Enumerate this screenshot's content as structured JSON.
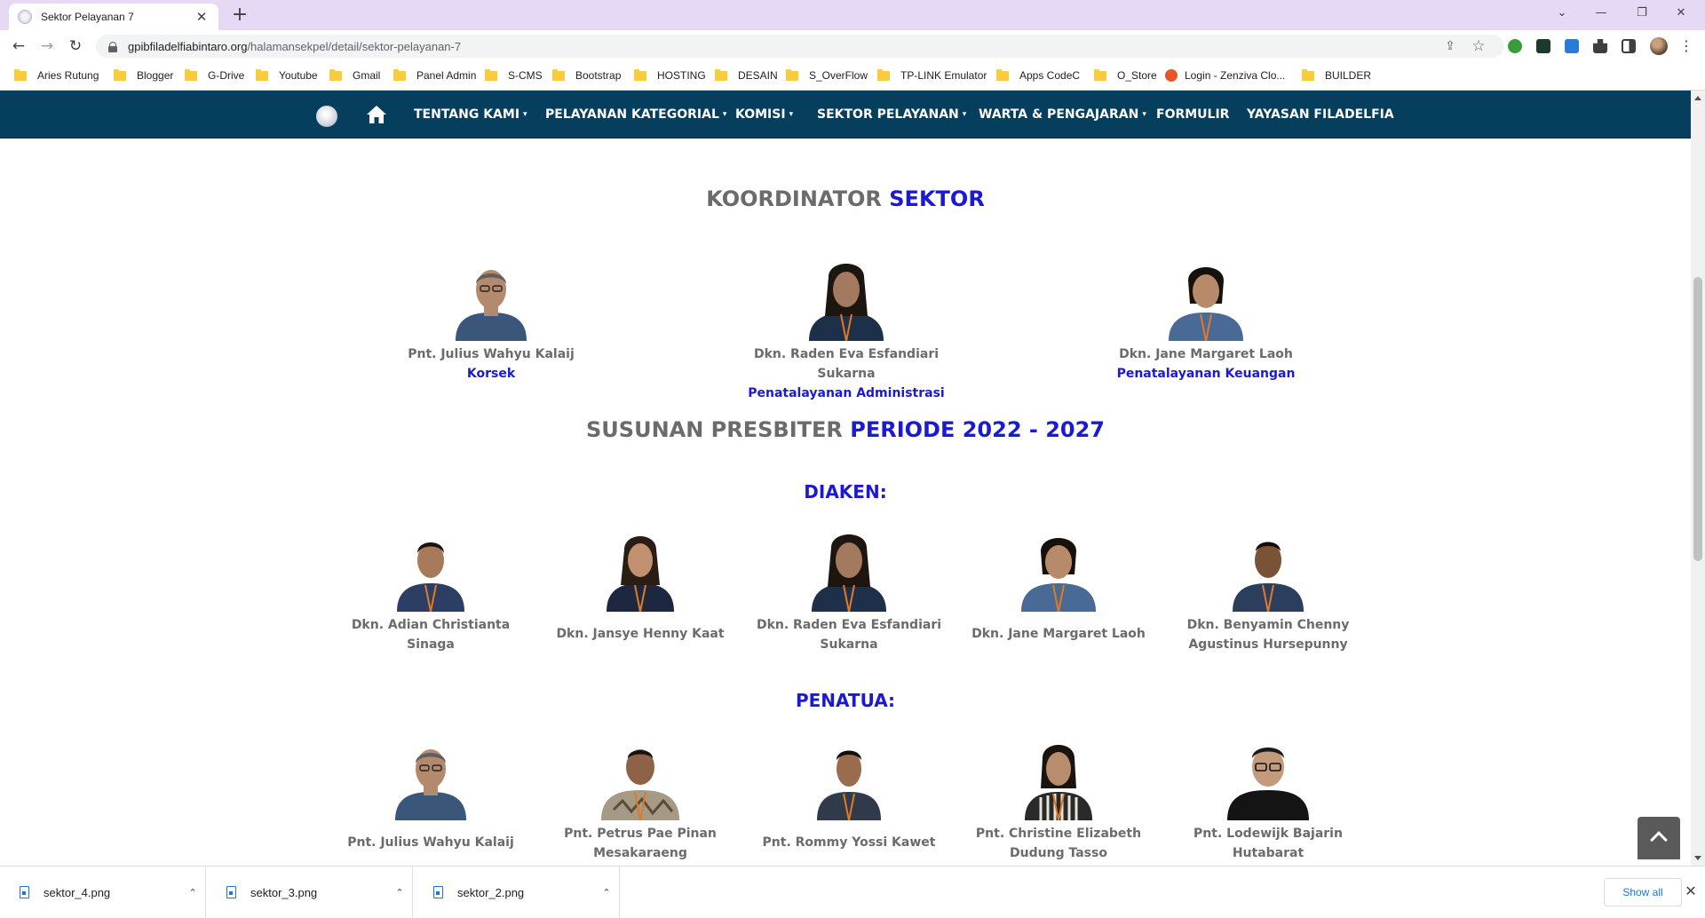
{
  "browser": {
    "tab_title": "Sektor Pelayanan 7",
    "tab_close": "✕",
    "new_tab": "+",
    "window_controls": [
      "⌄",
      "—",
      "❐",
      "✕"
    ],
    "nav": {
      "back": "←",
      "forward": "→",
      "reload": "↻"
    },
    "url_domain": "gpibfiladelfiabintaro.org",
    "url_path": "/halamansekpel/detail/sektor-pelayanan-7",
    "omni_icons": {
      "share": "⇪",
      "star": "☆",
      "menu": "⋮"
    },
    "bookmarks": [
      "Aries Rutung",
      "Blogger",
      "G-Drive",
      "Youtube",
      "Gmail",
      "Panel Admin",
      "S-CMS",
      "Bootstrap",
      "HOSTING",
      "DESAIN",
      "S_OverFlow",
      "TP-LINK Emulator",
      "Apps CodeC",
      "O_Store",
      "Login - Zenziva Clo...",
      "BUILDER"
    ]
  },
  "site_nav": {
    "items": [
      "TENTANG KAMI",
      "PELAYANAN KATEGORIAL",
      "KOMISI",
      "SEKTOR PELAYANAN",
      "WARTA & PENGAJARAN",
      "FORMULIR",
      "YAYASAN FILADELFIA"
    ],
    "caret": "▾"
  },
  "koordinator": {
    "title_gray": "KOORDINATOR",
    "title_blue": "SEKTOR",
    "people": [
      {
        "name": "Pnt. Julius Wahyu Kalaij",
        "role": "Korsek"
      },
      {
        "name": "Dkn. Raden Eva Esfandiari Sukarna",
        "role": "Penatalayanan Administrasi"
      },
      {
        "name": "Dkn. Jane Margaret Laoh",
        "role": "Penatalayanan Keuangan"
      }
    ]
  },
  "presbiter": {
    "title_gray": "SUSUNAN PRESBITER",
    "title_blue": "PERIODE 2022 - 2027"
  },
  "diaken": {
    "title": "DIAKEN:",
    "people": [
      {
        "line1": "Dkn. Adian Christianta",
        "line2": "Sinaga"
      },
      {
        "line1": "Dkn. Jansye Henny Kaat",
        "line2": ""
      },
      {
        "line1": "Dkn. Raden Eva Esfandiari",
        "line2": "Sukarna"
      },
      {
        "line1": "Dkn. Jane Margaret Laoh",
        "line2": ""
      },
      {
        "line1": "Dkn. Benyamin Chenny",
        "line2": "Agustinus Hursepunny"
      }
    ]
  },
  "penatua": {
    "title": "PENATUA:",
    "people": [
      {
        "line1": "Pnt. Julius Wahyu Kalaij",
        "line2": ""
      },
      {
        "line1": "Pnt. Petrus Pae Pinan",
        "line2": "Mesakaraeng"
      },
      {
        "line1": "Pnt. Rommy Yossi Kawet",
        "line2": ""
      },
      {
        "line1": "Pnt. Christine Elizabeth",
        "line2": "Dudung Tasso"
      },
      {
        "line1": "Pnt. Lodewijk Bajarin",
        "line2": "Hutabarat"
      }
    ]
  },
  "downloads": {
    "files": [
      "sektor_4.png",
      "sektor_3.png",
      "sektor_2.png"
    ],
    "chevron": "⌃",
    "show_all": "Show all",
    "close": "✕"
  },
  "colors": {
    "nav_bg": "#063e5e",
    "accent_blue": "#1a1ad6",
    "text_gray": "#6b6b6b",
    "tab_strip": "#e6d9f5"
  }
}
